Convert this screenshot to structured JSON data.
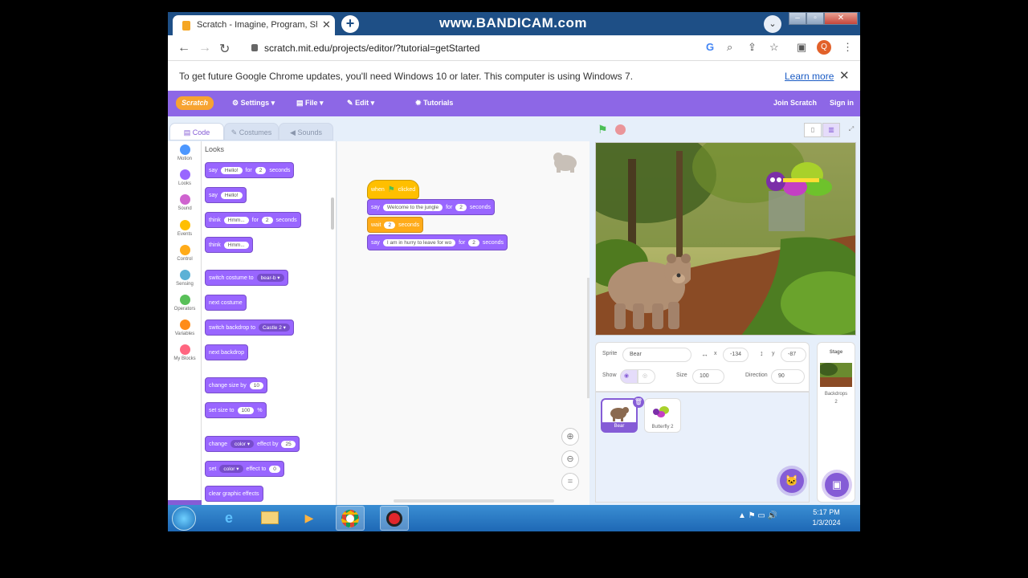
{
  "browser": {
    "tab_title": "Scratch - Imagine, Program, Sha",
    "watermark": "www.BANDICAM.com",
    "url": "scratch.mit.edu/projects/editor/?tutorial=getStarted",
    "profile_initial": "Q",
    "info_message": "To get future Google Chrome updates, you'll need Windows 10 or later. This computer is using Windows 7.",
    "learn_more": "Learn more"
  },
  "menubar": {
    "logo": "Scratch",
    "settings": "Settings",
    "file": "File",
    "edit": "Edit",
    "tutorials": "Tutorials",
    "join": "Join Scratch",
    "signin": "Sign in"
  },
  "tabs": {
    "code": "Code",
    "costumes": "Costumes",
    "sounds": "Sounds"
  },
  "categories": [
    {
      "label": "Motion",
      "color": "#4c97ff"
    },
    {
      "label": "Looks",
      "color": "#9966ff"
    },
    {
      "label": "Sound",
      "color": "#cf63cf"
    },
    {
      "label": "Events",
      "color": "#ffbf00"
    },
    {
      "label": "Control",
      "color": "#ffab19"
    },
    {
      "label": "Sensing",
      "color": "#5cb1d6"
    },
    {
      "label": "Operators",
      "color": "#59c059"
    },
    {
      "label": "Variables",
      "color": "#ff8c1a"
    },
    {
      "label": "My Blocks",
      "color": "#ff6680"
    }
  ],
  "palette": {
    "title": "Looks",
    "say_for": {
      "say": "say",
      "msg": "Hello!",
      "for": "for",
      "secs": "2",
      "unit": "seconds"
    },
    "say": {
      "say": "say",
      "msg": "Hello!"
    },
    "think_for": {
      "think": "think",
      "msg": "Hmm...",
      "for": "for",
      "secs": "2",
      "unit": "seconds"
    },
    "think": {
      "think": "think",
      "msg": "Hmm..."
    },
    "switch_costume": {
      "label": "switch costume to",
      "value": "bear-b"
    },
    "next_costume": "next costume",
    "switch_backdrop": {
      "label": "switch backdrop to",
      "value": "Castle 2"
    },
    "next_backdrop": "next backdrop",
    "change_size": {
      "label": "change size by",
      "value": "10"
    },
    "set_size": {
      "label": "set size to",
      "value": "100",
      "unit": "%"
    },
    "change_effect": {
      "label": "change",
      "effect": "color",
      "by": "effect by",
      "value": "25"
    },
    "set_effect": {
      "label": "set",
      "effect": "color",
      "to": "effect to",
      "value": "0"
    },
    "clear_effects": "clear graphic effects"
  },
  "script": {
    "hat": {
      "when": "when",
      "clicked": "clicked"
    },
    "say1": {
      "say": "say",
      "msg": "Welcome to the jungle",
      "for": "for",
      "secs": "2",
      "unit": "seconds"
    },
    "wait": {
      "wait": "wait",
      "secs": "2",
      "unit": "seconds"
    },
    "say2": {
      "say": "say",
      "msg": "I am in hurry to leave for wo",
      "for": "for",
      "secs": "2",
      "unit": "seconds"
    }
  },
  "sprite_info": {
    "sprite_label": "Sprite",
    "sprite_name": "Bear",
    "x_label": "x",
    "x_value": "-134",
    "y_label": "y",
    "y_value": "-87",
    "show_label": "Show",
    "size_label": "Size",
    "size_value": "100",
    "direction_label": "Direction",
    "direction_value": "90"
  },
  "sprites": [
    {
      "name": "Bear",
      "selected": true
    },
    {
      "name": "Butterfly 2",
      "selected": false
    }
  ],
  "stage_panel": {
    "label": "Stage",
    "backdrops_label": "Backdrops",
    "backdrops_count": "2"
  },
  "taskbar": {
    "time": "5:17 PM",
    "date": "1/3/2024"
  }
}
